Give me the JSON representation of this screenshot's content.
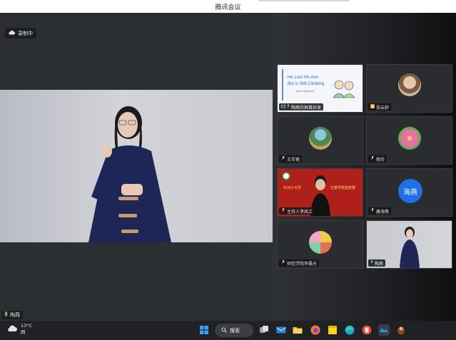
{
  "window": {
    "title": "腾讯会议"
  },
  "recording": {
    "label": "录制中",
    "icon": "cloud-icon"
  },
  "main_speaker": {
    "name": "陶燕",
    "mic_icon": "microphone-icon"
  },
  "share_slide": {
    "line1": "He Lost His Arm",
    "line2": "But is Still Climbing",
    "unit": "Unit 1  Section B"
  },
  "banner": {
    "line1": "石河子大学",
    "line2": "生教学技能竞赛"
  },
  "tiles": [
    {
      "label": "陶燕的屏幕共享"
    },
    {
      "label": "张云舒"
    },
    {
      "label": "王军艳"
    },
    {
      "label": "杨玲"
    },
    {
      "label": "主持人李凤江"
    },
    {
      "label": "唐海燕",
      "avatar_text": "海燕"
    },
    {
      "label": "师范学院李晨光"
    },
    {
      "label": "陶燕"
    }
  ],
  "taskbar": {
    "weather_temp": "13°C",
    "weather_desc": "阴",
    "search_label": "搜索",
    "icons": [
      "windows-start-icon",
      "task-view-icon",
      "mail-icon",
      "file-explorer-icon",
      "firefox-icon",
      "sticky-notes-icon",
      "edge-icon",
      "powerpoint-icon",
      "tencent-meeting-icon",
      "game-icon"
    ]
  },
  "colors": {
    "accent_blue": "#1f6fe6",
    "stage_bg": "#2b2e33",
    "taskbar_bg": "#1f2125"
  }
}
